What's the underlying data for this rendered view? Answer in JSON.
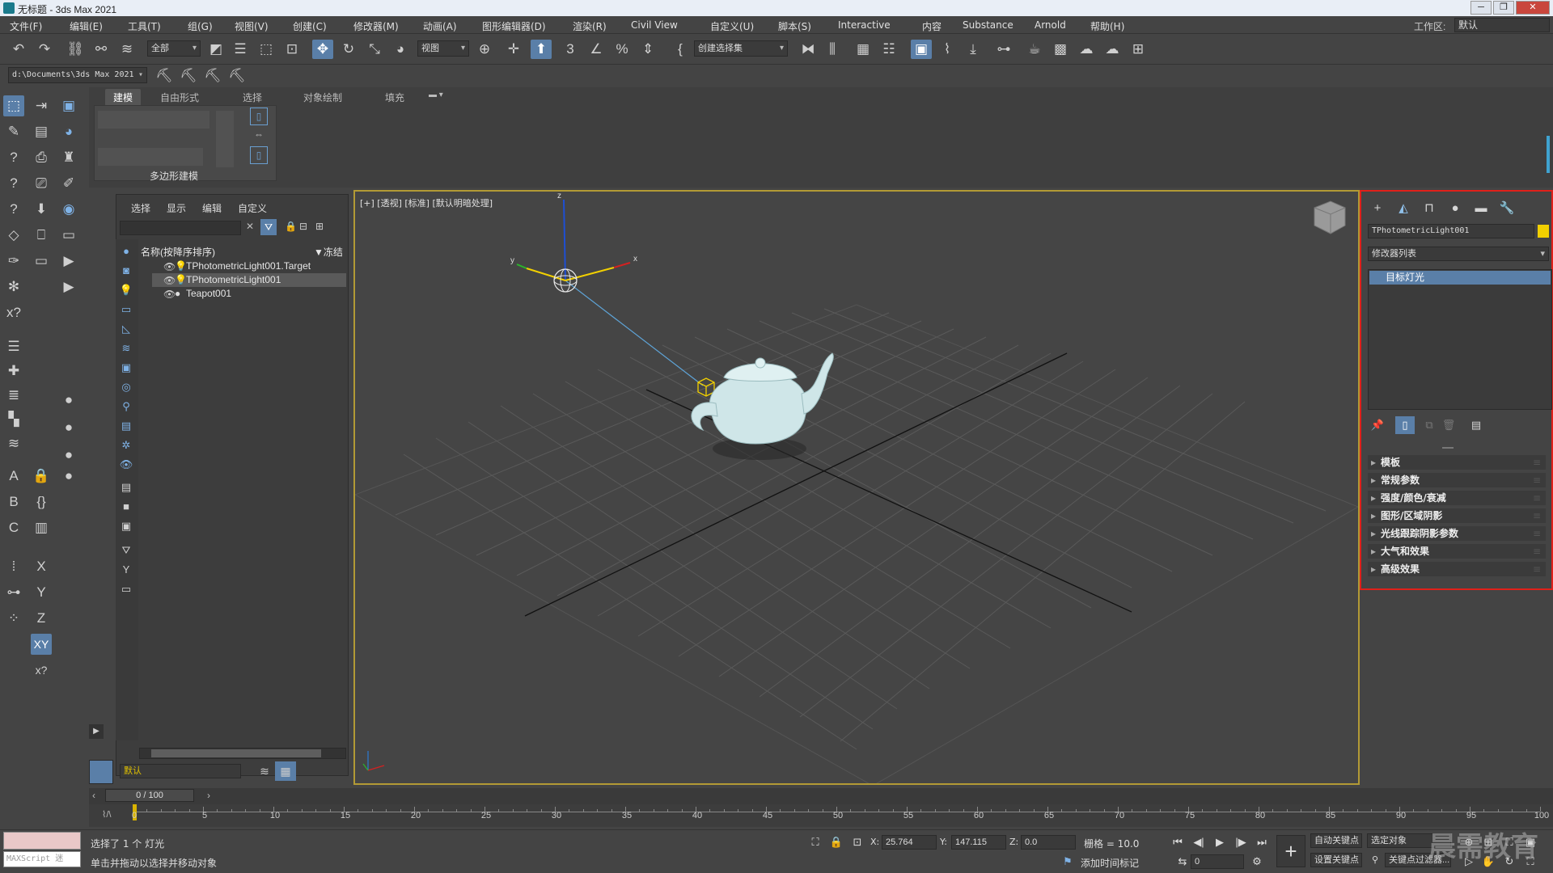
{
  "window": {
    "title": "无标题 - 3ds Max 2021"
  },
  "menu": {
    "items": [
      "文件(F)",
      "编辑(E)",
      "工具(T)",
      "组(G)",
      "视图(V)",
      "创建(C)",
      "修改器(M)",
      "动画(A)",
      "图形编辑器(D)",
      "渲染(R)",
      "Civil View",
      "自定义(U)",
      "脚本(S)",
      "Interactive",
      "内容",
      "Substance",
      "Arnold",
      "帮助(H)"
    ],
    "workspace_label": "工作区:",
    "workspace_value": "默认"
  },
  "toolbar": {
    "selection_filter": "全部",
    "ref_coord": "视图",
    "named_selection": "创建选择集"
  },
  "pathbar": {
    "path": "d:\\Documents\\3ds Max 2021"
  },
  "ribbon": {
    "tabs": [
      "建模",
      "自由形式",
      "选择",
      "对象绘制",
      "填充"
    ],
    "group_label": "多边形建模"
  },
  "explorer": {
    "tabs": [
      "选择",
      "显示",
      "编辑",
      "自定义"
    ],
    "column_name": "名称(按降序排序)",
    "column_frozen": "▼冻结",
    "rows": [
      {
        "name": "TPhotometricLight001.Target",
        "selected": false
      },
      {
        "name": "TPhotometricLight001",
        "selected": true
      },
      {
        "name": "Teapot001",
        "selected": false
      }
    ],
    "layer": "默认"
  },
  "viewport": {
    "label": "[+] [透视] [标准] [默认明暗处理]"
  },
  "command_panel": {
    "object_name": "TPhotometricLight001",
    "modifier_list": "修改器列表",
    "stack_item": "目标灯光",
    "rollouts": [
      "模板",
      "常规参数",
      "强度/颜色/衰减",
      "图形/区域阴影",
      "光线跟踪阴影参数",
      "大气和效果",
      "高级效果"
    ],
    "object_color": "#f2d000"
  },
  "timeline": {
    "frame_display": "0 / 100",
    "ticks": [
      0,
      5,
      10,
      15,
      20,
      25,
      30,
      35,
      40,
      45,
      50,
      55,
      60,
      65,
      70,
      75,
      80,
      85,
      90,
      95,
      100
    ]
  },
  "status": {
    "maxscript": "MAXScript 迷",
    "selection_info": "选择了 1 个 灯光",
    "prompt": "单击并拖动以选择并移动对象",
    "x_label": "X:",
    "x_value": "25.764",
    "y_label": "Y:",
    "y_value": "147.115",
    "z_label": "Z:",
    "z_value": "0.0",
    "grid": "栅格 = 10.0",
    "add_time_tag": "添加时间标记",
    "auto_key": "自动关键点",
    "set_key": "设置关键点",
    "selected_object": "选定对象",
    "key_filter": "关键点过滤器...",
    "frame_field": "0"
  },
  "watermark": "晨需教育",
  "colors": {
    "highlight": "#e0201a",
    "selection": "#5a7fa8",
    "viewport_border": "#b29a35",
    "teapot": "#cfe6e8"
  }
}
